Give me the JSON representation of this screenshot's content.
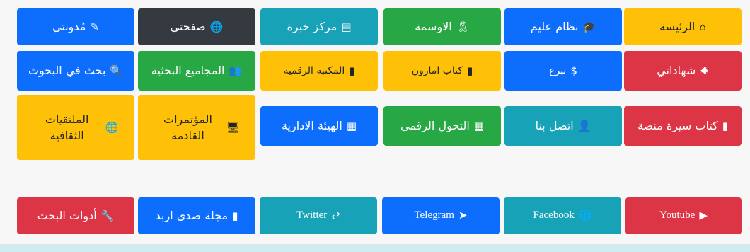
{
  "menu": {
    "row1": [
      {
        "label": "الرئيسة",
        "icon": "home-icon",
        "glyph": "⌂"
      },
      {
        "label": "نظام عليم",
        "icon": "graduation-cap-icon",
        "glyph": "🎓"
      },
      {
        "label": "الاوسمة",
        "icon": "ribbon-icon",
        "glyph": "🎗"
      },
      {
        "label": "مركز خبرة",
        "icon": "list-icon",
        "glyph": "▤"
      },
      {
        "label": "صفحتي",
        "icon": "globe-icon",
        "glyph": "🌐"
      },
      {
        "label": "مُدونتي",
        "icon": "blog-icon",
        "glyph": "✎"
      }
    ],
    "row2": [
      {
        "label": "شهاداتي",
        "icon": "certificate-icon",
        "glyph": "✹"
      },
      {
        "label": "تبرع",
        "icon": "donate-icon",
        "glyph": "$"
      },
      {
        "label": "كتاب امازون",
        "icon": "book-icon",
        "glyph": "▮"
      },
      {
        "label": "المكتبة الرقمية",
        "icon": "book-icon",
        "glyph": "▮"
      },
      {
        "label": "المجاميع البحثية",
        "icon": "users-icon",
        "glyph": "👥"
      },
      {
        "label": "بحث في البحوث",
        "icon": "search-icon",
        "glyph": "🔍"
      }
    ],
    "row3": [
      {
        "label": "كتاب سيرة منصة",
        "icon": "book-icon",
        "glyph": "▮"
      },
      {
        "label": "اتصل بنا",
        "icon": "user-icon",
        "glyph": "👤"
      },
      {
        "label": "التحول الرقمي",
        "icon": "microchip-icon",
        "glyph": "▦"
      },
      {
        "label": "الهيئة الادارية",
        "icon": "microchip-icon",
        "glyph": "▦"
      },
      {
        "label": "المؤتمرات القادمة",
        "icon": "desktop-icon",
        "glyph": "🖥"
      },
      {
        "label": "الملتقيات الثقافية",
        "icon": "globe-icon",
        "glyph": "🌐"
      }
    ],
    "social": [
      {
        "label": "Youtube",
        "icon": "youtube-icon",
        "glyph": "▶"
      },
      {
        "label": "Facebook",
        "icon": "globe-icon",
        "glyph": "🌐"
      },
      {
        "label": "Telegram",
        "icon": "paper-plane-icon",
        "glyph": "➤"
      },
      {
        "label": "Twitter",
        "icon": "retweet-icon",
        "glyph": "⇄"
      },
      {
        "label": "مجلة صدى اربد",
        "icon": "book-icon",
        "glyph": "▮"
      },
      {
        "label": "أدوات البحث",
        "icon": "wrench-icon",
        "glyph": "🔧"
      }
    ]
  },
  "colors": {
    "yellow": "#ffc107",
    "blue": "#0d6efd",
    "green": "#28a745",
    "teal": "#17a2b8",
    "dark": "#343a40",
    "red": "#dc3545",
    "alert": "#d1ecf1"
  }
}
